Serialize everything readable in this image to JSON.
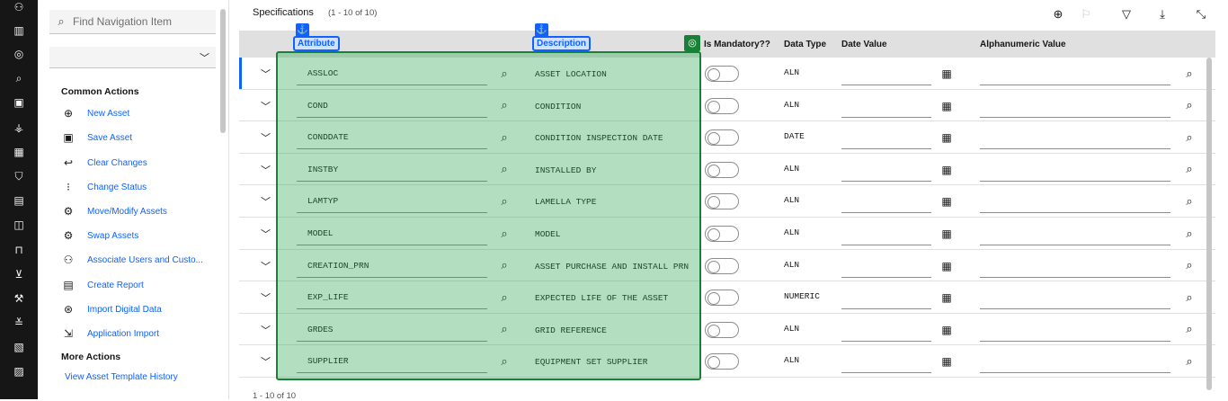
{
  "nav_search": {
    "placeholder": "Find Navigation Item"
  },
  "common_actions_title": "Common Actions",
  "common_actions": [
    {
      "label": "New Asset",
      "icon": "add-circle-icon"
    },
    {
      "label": "Save Asset",
      "icon": "save-icon"
    },
    {
      "label": "Clear Changes",
      "icon": "undo-icon"
    },
    {
      "label": "Change Status",
      "icon": "change-status-icon"
    },
    {
      "label": "Move/Modify Assets",
      "icon": "move-modify-icon"
    },
    {
      "label": "Swap Assets",
      "icon": "swap-icon"
    },
    {
      "label": "Associate Users and Custo...",
      "icon": "users-icon"
    },
    {
      "label": "Create Report",
      "icon": "report-icon"
    },
    {
      "label": "Import Digital Data",
      "icon": "import-data-icon"
    },
    {
      "label": "Application Import",
      "icon": "application-import-icon"
    }
  ],
  "more_actions_title": "More Actions",
  "more_actions": [
    {
      "label": "View Asset Template History"
    }
  ],
  "table": {
    "title": "Specifications",
    "count": "(1 - 10 of 10)",
    "columns": {
      "attribute": "Attribute",
      "description": "Description",
      "mandatory": "Is Mandatory??",
      "datatype": "Data Type",
      "datevalue": "Date Value",
      "alnvalue": "Alphanumeric Value"
    },
    "rows": [
      {
        "attribute": "ASSLOC",
        "description": "ASSET LOCATION",
        "datatype": "ALN"
      },
      {
        "attribute": "COND",
        "description": "CONDITION",
        "datatype": "ALN"
      },
      {
        "attribute": "CONDDATE",
        "description": "CONDITION INSPECTION DATE",
        "datatype": "DATE"
      },
      {
        "attribute": "INSTBY",
        "description": "INSTALLED BY",
        "datatype": "ALN"
      },
      {
        "attribute": "LAMTYP",
        "description": "LAMELLA TYPE",
        "datatype": "ALN"
      },
      {
        "attribute": "MODEL",
        "description": "MODEL",
        "datatype": "ALN"
      },
      {
        "attribute": "CREATION_PRN",
        "description": "ASSET PURCHASE AND INSTALL PRN",
        "datatype": "ALN"
      },
      {
        "attribute": "EXP_LIFE",
        "description": "EXPECTED LIFE OF THE ASSET",
        "datatype": "NUMERIC"
      },
      {
        "attribute": "GRDES",
        "description": "GRID REFERENCE",
        "datatype": "ALN"
      },
      {
        "attribute": "SUPPLIER",
        "description": "EQUIPMENT SET SUPPLIER",
        "datatype": "ALN"
      }
    ],
    "pager": "1 - 10 of 10"
  },
  "colors": {
    "accent": "#0f62fe",
    "highlight": "#24a148",
    "rail": "#161616"
  }
}
